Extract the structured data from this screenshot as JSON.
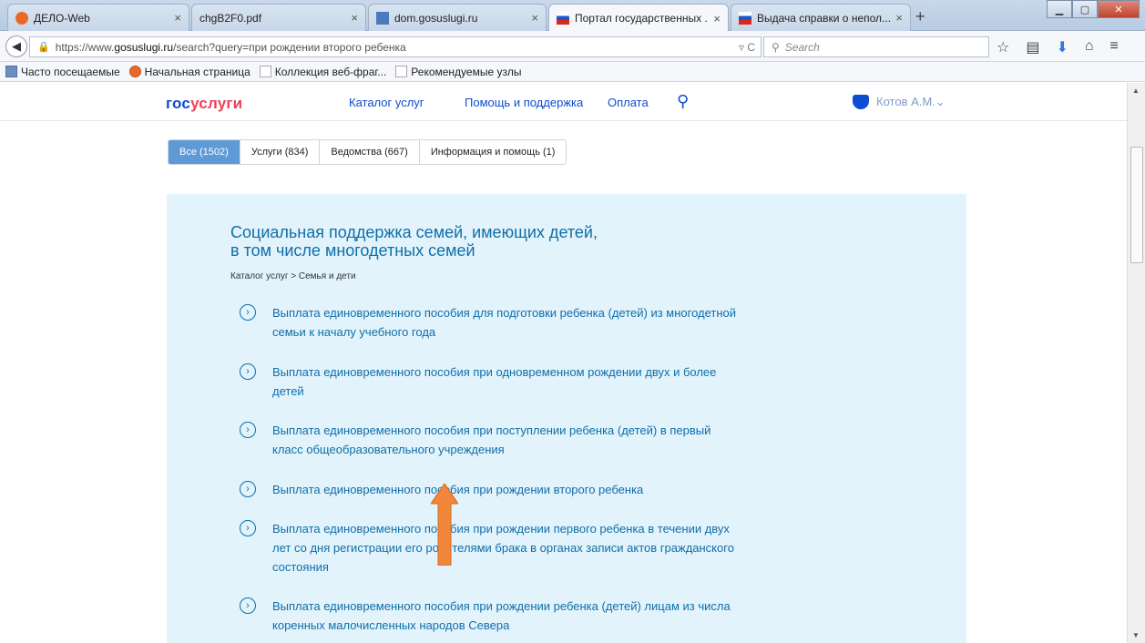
{
  "browser": {
    "tabs": [
      {
        "label": "ДЕЛО-Web",
        "icon": "delo-icon",
        "color": "#e86a2a"
      },
      {
        "label": "chgB2F0.pdf",
        "icon": "",
        "color": ""
      },
      {
        "label": "dom.gosuslugi.ru",
        "icon": "house-icon",
        "color": "#4b7bbf"
      },
      {
        "label": "Портал государственных ...",
        "icon": "flag-icon",
        "color": "#d52b1e"
      },
      {
        "label": "Выдача справки о непол...",
        "icon": "flag-icon",
        "color": "#d52b1e"
      }
    ],
    "close_glyph": "×",
    "newtab_glyph": "+",
    "url_prefix": "https://www.",
    "url_host": "gosuslugi.ru",
    "url_rest": "/search?query=при рождении второго ребенка",
    "url_end": "▿ C",
    "search_placeholder": "Search",
    "bookmarks": [
      "Часто посещаемые",
      "Начальная страница",
      "Коллекция веб-фраг...",
      "Рекомендуемые узлы"
    ]
  },
  "site": {
    "logo_part1": "гос",
    "logo_part2": "услуги",
    "nav": [
      "Каталог услуг",
      "Помощь и поддержка",
      "Оплата"
    ],
    "user_name": "Котов А.М.⌄"
  },
  "filters": [
    "Все (1502)",
    "Услуги (834)",
    "Ведомства (667)",
    "Информация и помощь (1)"
  ],
  "active_filter": 0,
  "panel": {
    "title_line1": "Социальная поддержка семей, имеющих детей,",
    "title_line2": "в том числе многодетных семей",
    "breadcrumb": "Каталог услуг > Семья и дети",
    "services": [
      {
        "line1": "Выплата единовременного пособия для подготовки ребенка (детей) из многодетной",
        "line2": "семьи к началу учебного года",
        "line3": ""
      },
      {
        "line1": "Выплата единовременного пособия при одновременном рождении двух и более",
        "line2": "детей",
        "line3": ""
      },
      {
        "line1": "Выплата единовременного пособия при поступлении ребенка (детей) в первый",
        "line2": "класс общеобразовательного учреждения",
        "line3": ""
      },
      {
        "line1": "Выплата единовременного пособия при рождении второго ребенка",
        "line2": "",
        "line3": ""
      },
      {
        "line1": "Выплата единовременного пособия при рождении первого ребенка в течении двух",
        "line2": "лет со дня регистрации его родителями брака в органах записи актов гражданского",
        "line3": "состояния"
      },
      {
        "line1": "Выплата единовременного пособия при рождении ребенка (детей) лицам из числа",
        "line2": "коренных малочисленных народов Севера",
        "line3": ""
      }
    ]
  },
  "annotation_arrow_color": "#f0873a"
}
